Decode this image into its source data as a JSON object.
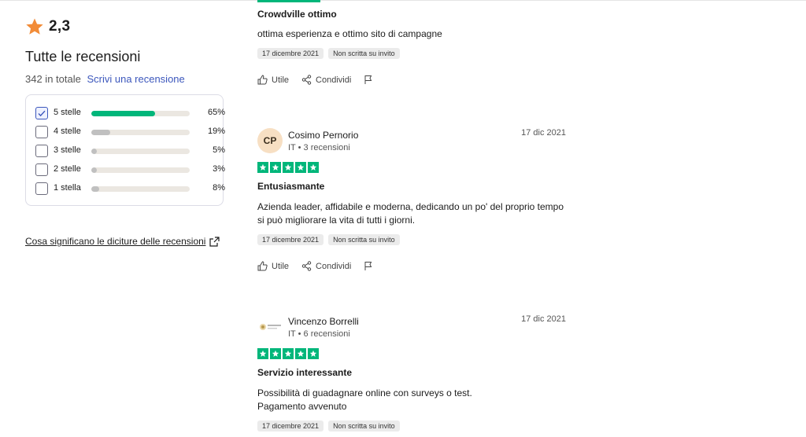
{
  "colors": {
    "green": "#00b67a",
    "link": "#3c57bc",
    "gray_bar": "#c0c0c0",
    "track": "#ebe7e1"
  },
  "summary": {
    "rating": "2,3",
    "title": "Tutte le recensioni",
    "total": "342 in totale",
    "write_review": "Scrivi una recensione"
  },
  "filters": [
    {
      "label": "5 stelle",
      "percent": "65%",
      "fill": 0.65,
      "checked": true
    },
    {
      "label": "4 stelle",
      "percent": "19%",
      "fill": 0.19,
      "checked": false
    },
    {
      "label": "3 stelle",
      "percent": "5%",
      "fill": 0.05,
      "checked": false
    },
    {
      "label": "2 stelle",
      "percent": "3%",
      "fill": 0.03,
      "checked": false
    },
    {
      "label": "1 stella",
      "percent": "8%",
      "fill": 0.08,
      "checked": false
    }
  ],
  "meaning_link": "Cosa significano le diciture delle recensioni",
  "actions": {
    "useful": "Utile",
    "share": "Condividi"
  },
  "reviews": [
    {
      "title": "Crowdville ottimo",
      "body": "ottima esperienza e ottimo sito di campagne",
      "badges": [
        "17 dicembre 2021",
        "Non scritta su invito"
      ]
    },
    {
      "avatar": "CP",
      "author": "Cosimo Pernorio",
      "meta": "IT • 3 recensioni",
      "date": "17 dic 2021",
      "title": "Entusiasmante",
      "body": "Azienda leader, affidabile e moderna, dedicando un po' del proprio tempo si può migliorare la vita di tutti i giorni.",
      "badges": [
        "17 dicembre 2021",
        "Non scritta su invito"
      ],
      "stars": 5
    },
    {
      "author": "Vincenzo Borrelli",
      "meta": "IT • 6 recensioni",
      "date": "17 dic 2021",
      "title": "Servizio interessante",
      "body_line1": "Possibilità di guadagnare online con surveys o test.",
      "body_line2": "Pagamento avvenuto",
      "badges": [
        "17 dicembre 2021",
        "Non scritta su invito"
      ],
      "stars": 5
    }
  ]
}
